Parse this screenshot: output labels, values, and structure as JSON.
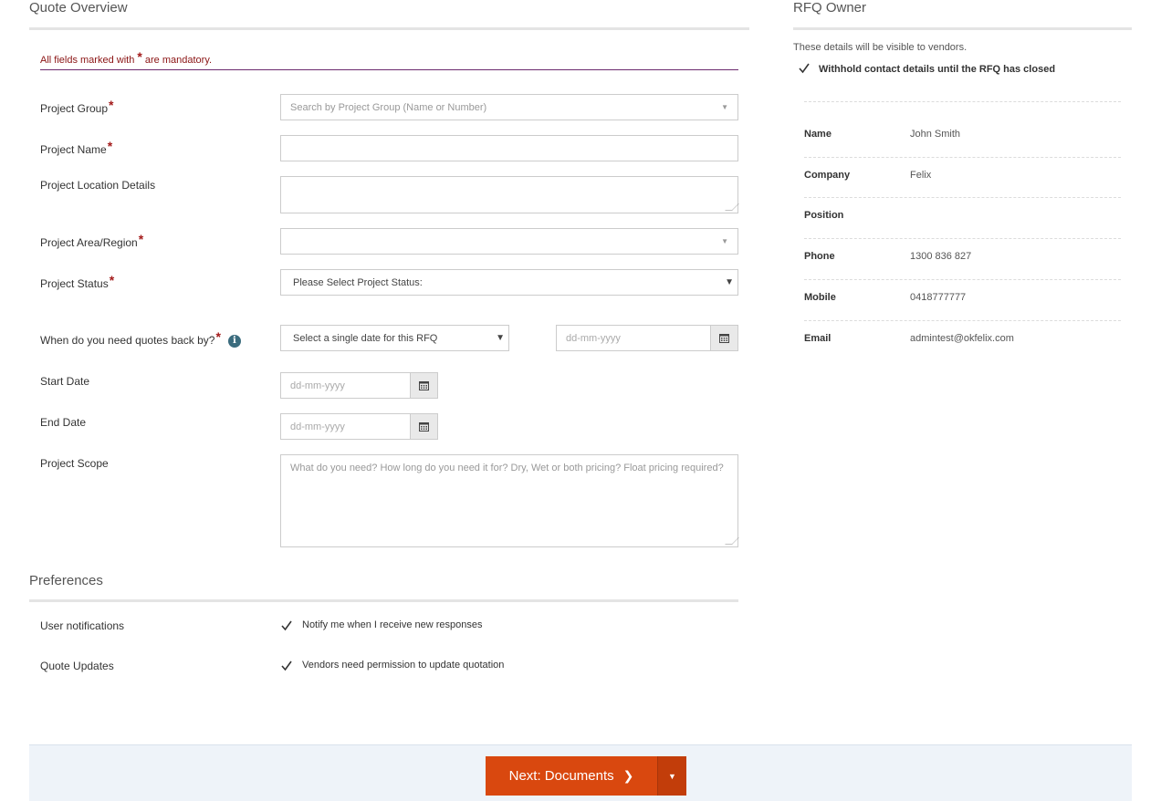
{
  "quote_overview": {
    "title": "Quote Overview",
    "mandatory_note": "All fields marked with",
    "mandatory_star": "*",
    "mandatory_suffix": "are mandatory.",
    "fields": {
      "project_group": {
        "label": "Project Group",
        "placeholder": "Search by Project Group (Name or Number)"
      },
      "project_name": {
        "label": "Project Name",
        "value": ""
      },
      "project_location": {
        "label": "Project Location Details",
        "value": ""
      },
      "project_area": {
        "label": "Project Area/Region",
        "value": ""
      },
      "project_status": {
        "label": "Project Status",
        "selected": "Please Select Project Status:"
      },
      "quotes_back": {
        "label": "When do you need quotes back by?",
        "selected": "Select a single date for this RFQ",
        "date_placeholder": "dd-mm-yyyy"
      },
      "start_date": {
        "label": "Start Date",
        "placeholder": "dd-mm-yyyy"
      },
      "end_date": {
        "label": "End Date",
        "placeholder": "dd-mm-yyyy"
      },
      "project_scope": {
        "label": "Project Scope",
        "placeholder": "What do you need? How long do you need it for? Dry, Wet or both pricing? Float pricing required?"
      }
    },
    "required_star": "*",
    "info_glyph": "i"
  },
  "preferences": {
    "title": "Preferences",
    "user_notifications": {
      "label": "User notifications",
      "checkbox_label": "Notify me when I receive new responses",
      "checked": true
    },
    "quote_updates": {
      "label": "Quote Updates",
      "checkbox_label": "Vendors need permission to update quotation",
      "checked": true
    }
  },
  "rfq_owner": {
    "title": "RFQ Owner",
    "visibility_note": "These details will be visible to vendors.",
    "withhold_label": "Withhold contact details until the RFQ has closed",
    "withhold_checked": true,
    "rows": [
      {
        "label": "Name",
        "value": "John Smith"
      },
      {
        "label": "Company",
        "value": "Felix"
      },
      {
        "label": "Position",
        "value": ""
      },
      {
        "label": "Phone",
        "value": "1300 836 827"
      },
      {
        "label": "Mobile",
        "value": "0418777777"
      },
      {
        "label": "Email",
        "value": "admintest@okfelix.com"
      }
    ]
  },
  "footer": {
    "next_label": "Next: Documents",
    "next_arrow": "❯",
    "dropdown_caret": "▼"
  },
  "colors": {
    "accent": "#d9480f",
    "required": "#a31a1a",
    "info": "#3b6c7e",
    "footer_bg": "#eef3f9"
  }
}
